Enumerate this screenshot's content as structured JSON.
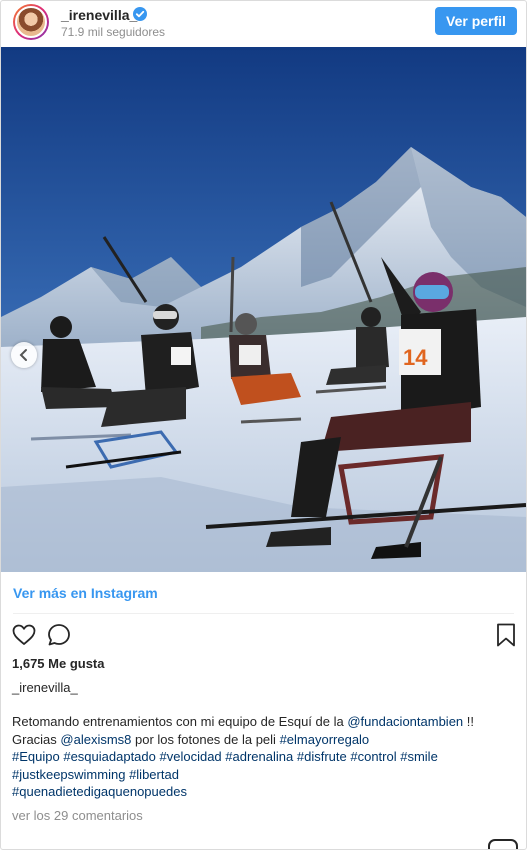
{
  "header": {
    "username": "_irenevilla_",
    "followers": "71.9 mil seguidores",
    "follow_button": "Ver perfil"
  },
  "photo": {
    "bib_number": "14"
  },
  "view_more": "Ver más en Instagram",
  "likes": "1,675 Me gusta",
  "author": "_irenevilla_",
  "caption": {
    "line1_text": "Retomando entrenamientos con mi equipo de Esquí de la ",
    "line1_mention": "@fundaciontambien",
    "line1_end": " !!",
    "line2_start": "Gracias ",
    "line2_mention": "@alexisms8",
    "line2_text": " por los fotones de la peli ",
    "line2_tag": "#elmayorregalo",
    "hashtags_line3": [
      "#Equipo",
      "#esquiadaptado",
      "#velocidad",
      "#adrenalina",
      "#disfrute",
      "#control",
      "#smile"
    ],
    "hashtags_line4": [
      "#justkeepswimming",
      "#libertad"
    ],
    "hashtags_line5": [
      "#quenadietedigaquenopuedes"
    ]
  },
  "comments_link": "ver los 29 comentarios",
  "colors": {
    "accent": "#3897f0",
    "link": "#003569",
    "muted": "#8e8e8e",
    "text": "#262626"
  },
  "icons": [
    "verified-badge-icon",
    "heart-icon",
    "comment-icon",
    "bookmark-icon",
    "chevron-left-icon"
  ]
}
